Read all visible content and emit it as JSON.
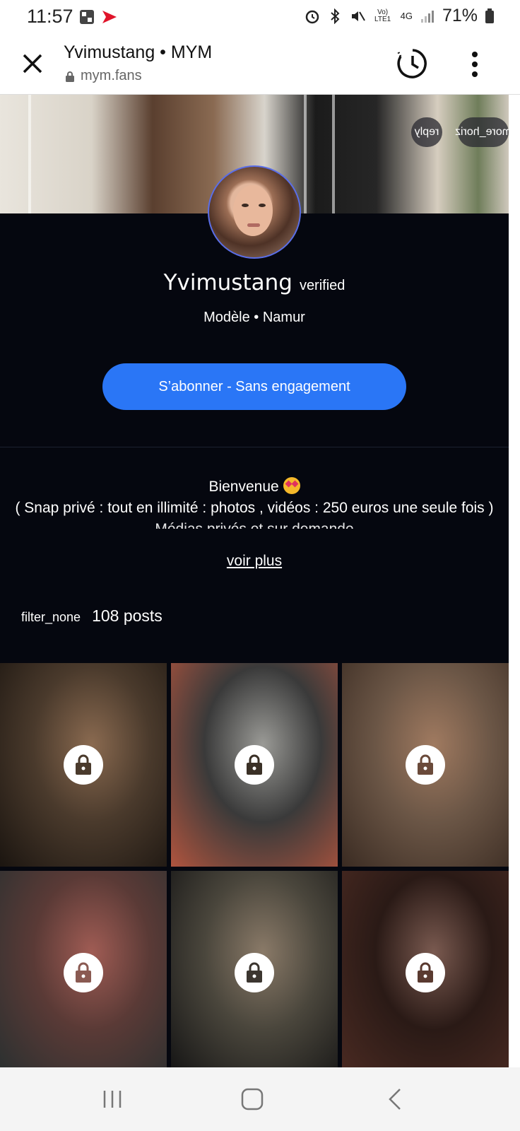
{
  "status_bar": {
    "time": "11:57",
    "network_label": "4G",
    "volte_label": "Vo) LTE1",
    "battery": "71%"
  },
  "browser": {
    "title": "Yvimustang • MYM",
    "url": "mym.fans"
  },
  "cover": {
    "more_chip": "more_horiz",
    "reply_chip": "reply"
  },
  "profile": {
    "name": "Yvimustang",
    "verified_label": "verified",
    "subtitle": "Modèle • Namur",
    "subscribe_label": "S’abonner - Sans engagement"
  },
  "bio": {
    "line1": "Bienvenue",
    "line2": "( Snap privé : tout en illimité : photos , vidéos : 250 euros une seule fois )",
    "line3": "Médias privés et sur demande",
    "see_more": "voir plus"
  },
  "posts": {
    "filter_icon_label": "filter_none",
    "count_label": "108 posts"
  },
  "tiles": [
    {
      "a": "#4a3a2c",
      "b": "#8a6a50",
      "c": "#1b1510",
      "lock_color": "#4a3a2c"
    },
    {
      "a": "#3a3a3a",
      "b": "#9a9a96",
      "c": "#b0543e",
      "lock_color": "#3a3026"
    },
    {
      "a": "#6b5646",
      "b": "#a07a60",
      "c": "#3a2b22",
      "lock_color": "#6a4a3a"
    },
    {
      "a": "#5a3a36",
      "b": "#a05c54",
      "c": "#2a3030",
      "lock_color": "#8a5a52"
    },
    {
      "a": "#4a463c",
      "b": "#8a7a68",
      "c": "#141414",
      "lock_color": "#3c3630"
    },
    {
      "a": "#2a1a16",
      "b": "#7a5a50",
      "c": "#4a2a22",
      "lock_color": "#5a3a30"
    }
  ]
}
